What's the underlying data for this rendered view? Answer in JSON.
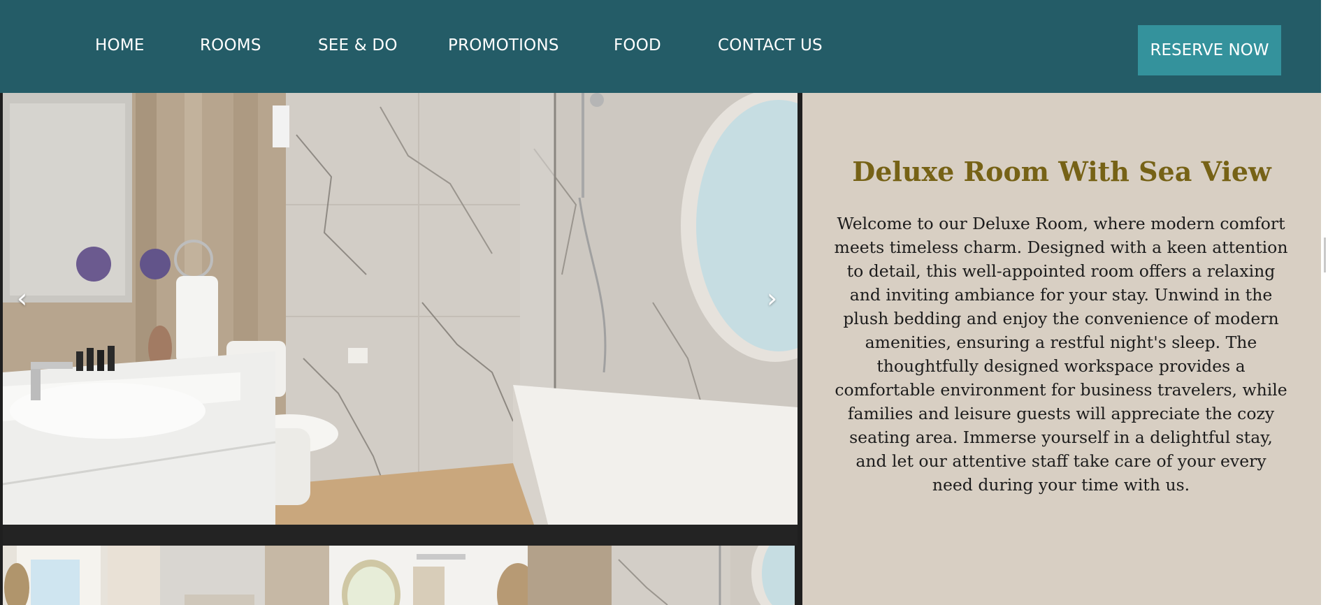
{
  "nav": {
    "items": [
      "HOME",
      "ROOMS",
      "SEE & DO",
      "PROMOTIONS",
      "FOOD",
      "CONTACT US"
    ],
    "reserve_label": "RESERVE NOW"
  },
  "gallery": {
    "prev_label": "‹",
    "next_label": "›",
    "thumbnail_count": 4
  },
  "room": {
    "title": "Deluxe Room With Sea View",
    "description": "Welcome to our Deluxe Room, where modern comfort meets timeless charm. Designed with a keen attention to detail, this well-appointed room offers a relaxing and inviting ambiance for your stay. Unwind in the plush bedding and enjoy the convenience of modern amenities, ensuring a restful night's sleep. The thoughtfully designed workspace provides a comfortable environment for business travelers, while families and leisure guests will appreciate the cozy seating area. Immerse yourself in a delightful stay, and let our attentive staff take care of your every need during your time with us."
  },
  "colors": {
    "nav_bg": "#245c67",
    "reserve_bg": "#34929c",
    "panel_bg": "#d8cfc3",
    "title_color": "#766216"
  }
}
